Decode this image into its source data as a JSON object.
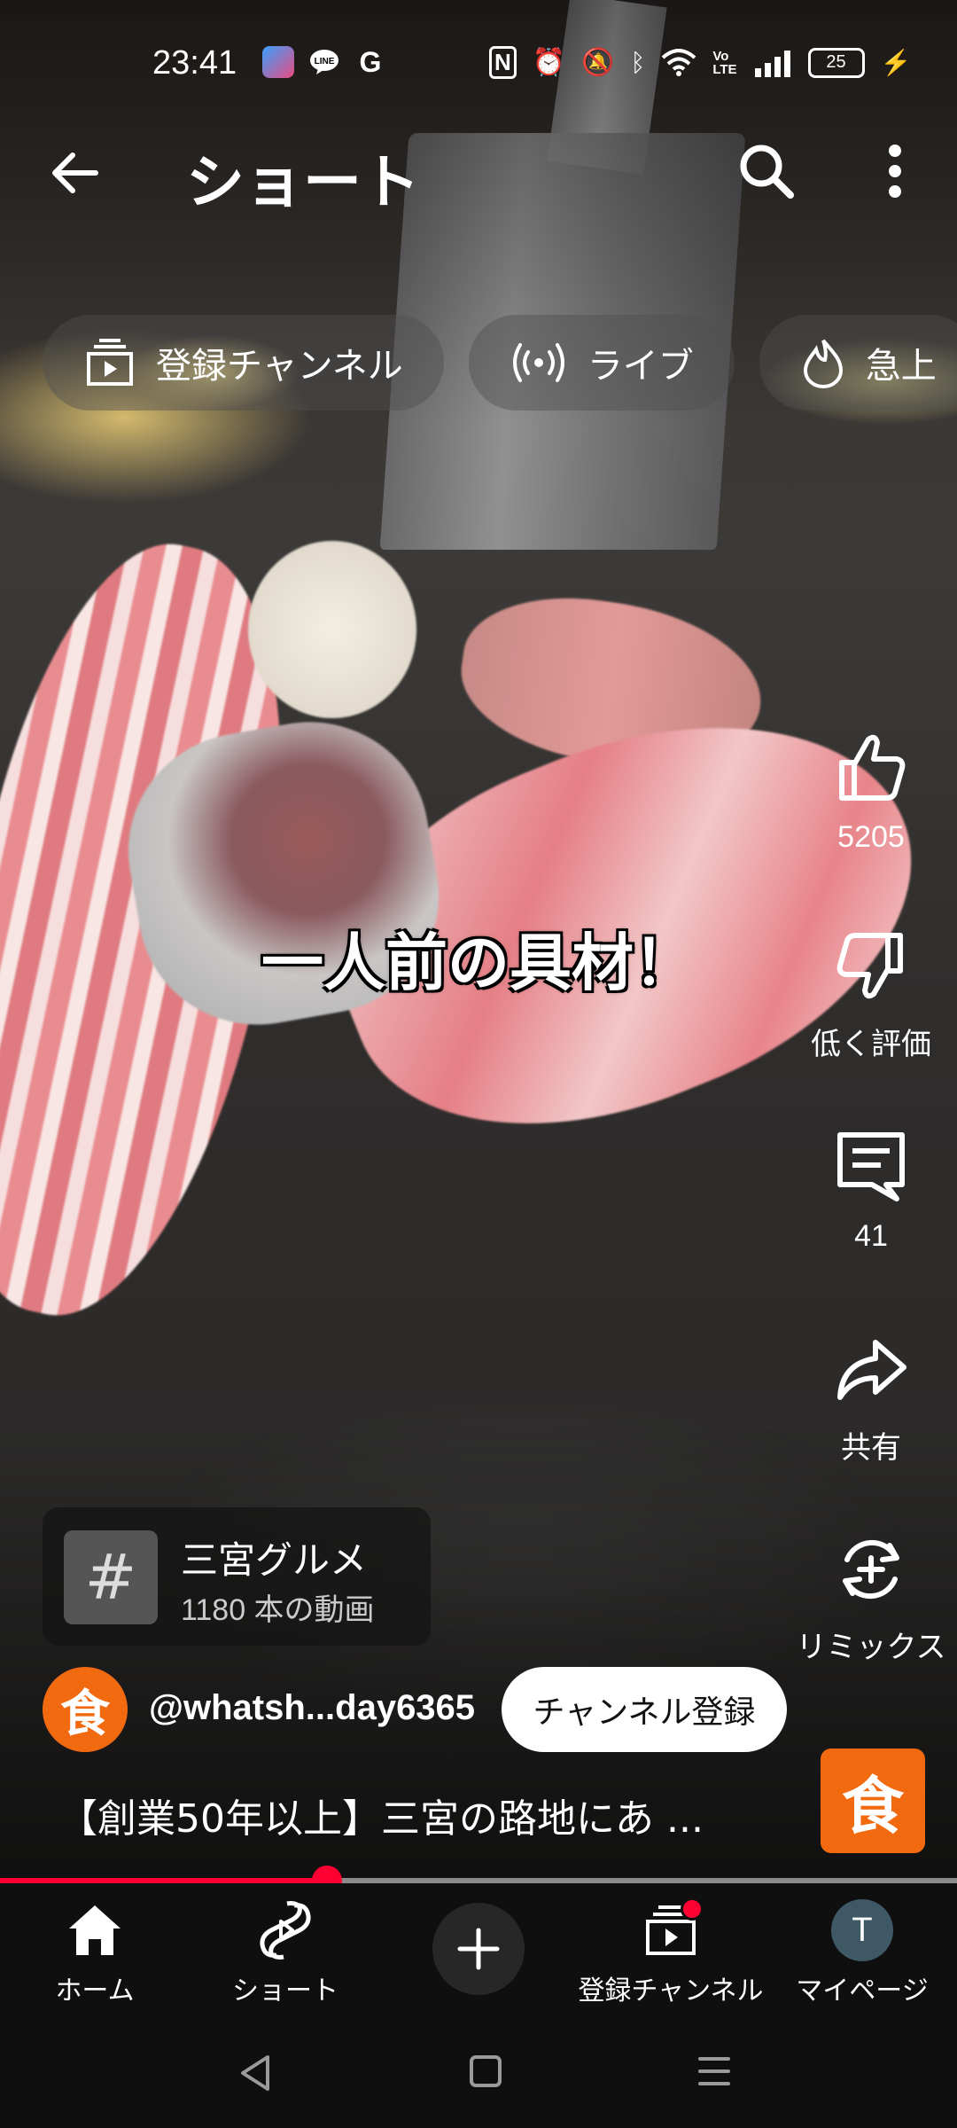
{
  "status_bar": {
    "time": "23:41",
    "notification_icons": [
      "app-icon",
      "line-icon",
      "google-icon"
    ],
    "status_icons": [
      "nfc-icon",
      "alarm-icon",
      "mute-icon",
      "bluetooth-icon",
      "wifi-icon",
      "volte-icon",
      "signal-icon"
    ],
    "battery_level": "25"
  },
  "header": {
    "title": "ショート"
  },
  "chips": [
    {
      "icon": "subscriptions-icon",
      "label": "登録チャンネル"
    },
    {
      "icon": "live-icon",
      "label": "ライブ"
    },
    {
      "icon": "trending-icon",
      "label": "急上"
    }
  ],
  "video": {
    "caption": "一人前の具材！"
  },
  "actions": {
    "like_count": "5205",
    "dislike_label": "低く評価",
    "comment_count": "41",
    "share_label": "共有",
    "remix_label": "リミックス"
  },
  "hashtag": {
    "symbol": "#",
    "title": "三宮グルメ",
    "subtitle": "1180 本の動画"
  },
  "channel": {
    "avatar_char": "食",
    "handle": "@whatsh...day6365",
    "subscribe_label": "チャンネル登録",
    "video_title": "【創業50年以上】三宮の路地にあ ...",
    "badge_char": "食"
  },
  "progress": {
    "fraction": 0.342
  },
  "colors": {
    "accent": "#ff0033",
    "brand_orange": "#f26a10",
    "nav_bg": "#0f0f0f"
  },
  "bottom_nav": {
    "home": "ホーム",
    "shorts": "ショート",
    "subscriptions": "登録チャンネル",
    "my_page": "マイページ",
    "avatar_initial": "T"
  }
}
